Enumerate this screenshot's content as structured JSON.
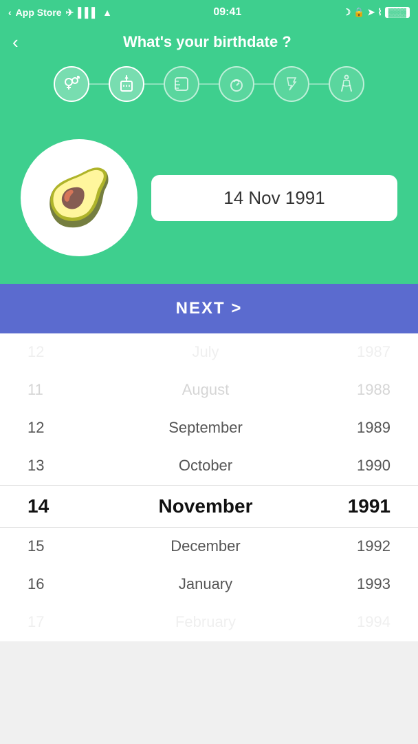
{
  "statusBar": {
    "appStore": "App Store",
    "time": "09:41"
  },
  "header": {
    "backLabel": "‹",
    "title": "What's your birthdate ?"
  },
  "steps": [
    {
      "icon": "⚥",
      "active": true
    },
    {
      "icon": "🕯",
      "active": false
    },
    {
      "icon": "📏",
      "active": false
    },
    {
      "icon": "⚖",
      "active": false
    },
    {
      "icon": "🏆",
      "active": false
    },
    {
      "icon": "🚶",
      "active": false
    }
  ],
  "selectedDate": "14 Nov 1991",
  "nextButton": "NEXT >",
  "pickerRows": [
    {
      "day": "12",
      "month": "July",
      "year": "1987",
      "state": "very-faded"
    },
    {
      "day": "11",
      "month": "August",
      "year": "1988",
      "state": "faded"
    },
    {
      "day": "12",
      "month": "September",
      "year": "1989",
      "state": "normal"
    },
    {
      "day": "13",
      "month": "October",
      "year": "1990",
      "state": "normal"
    },
    {
      "day": "14",
      "month": "November",
      "year": "1991",
      "state": "selected"
    },
    {
      "day": "15",
      "month": "December",
      "year": "1992",
      "state": "normal"
    },
    {
      "day": "16",
      "month": "January",
      "year": "1993",
      "state": "normal"
    },
    {
      "day": "17",
      "month": "February",
      "year": "1994",
      "state": "very-faded"
    }
  ]
}
